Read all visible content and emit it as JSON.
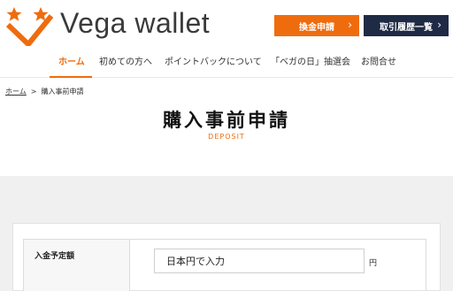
{
  "brand": {
    "name": "Vega wallet",
    "logo_icon": "vega-stars-logo",
    "accent_color": "#ef6c0e",
    "dark_color": "#1f2a44"
  },
  "header_buttons": {
    "exchange": {
      "label": "換金申請",
      "icon": "chevron-right-icon",
      "glyph": "›"
    },
    "history": {
      "label": "取引履歴一覧",
      "icon": "chevron-right-icon",
      "glyph": "›"
    }
  },
  "nav": {
    "items": [
      {
        "label": "ホーム",
        "active": true
      },
      {
        "label": "初めての方へ",
        "active": false
      },
      {
        "label": "ポイントバックについて",
        "active": false
      },
      {
        "label": "「ベガの日」抽選会",
        "active": false
      },
      {
        "label": "お問合せ",
        "active": false
      }
    ]
  },
  "breadcrumb": {
    "home": "ホーム",
    "separator": ">",
    "current": "購入事前申請"
  },
  "page": {
    "title": "購入事前申請",
    "subtitle": "DEPOSIT"
  },
  "form": {
    "amount_label": "入金予定額",
    "amount_value": "日本円で入力",
    "amount_unit": "円"
  }
}
